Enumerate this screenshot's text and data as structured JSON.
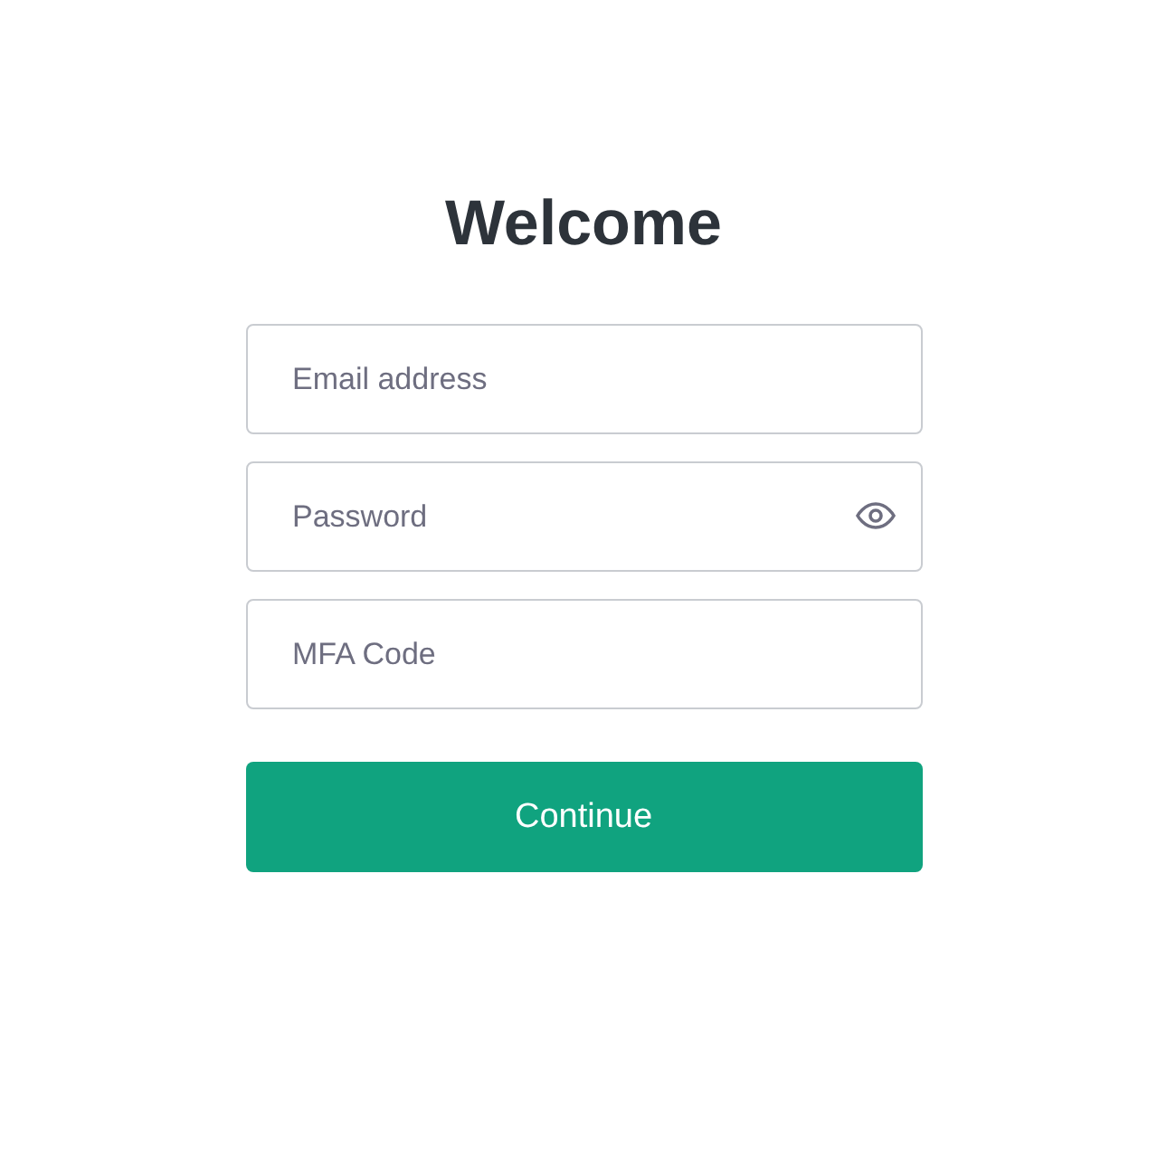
{
  "title": "Welcome",
  "fields": [
    {
      "placeholder": "Email address",
      "kind": "text"
    },
    {
      "placeholder": "Password",
      "kind": "password"
    },
    {
      "placeholder": "MFA Code",
      "kind": "text"
    }
  ],
  "button": {
    "label": "Continue"
  }
}
